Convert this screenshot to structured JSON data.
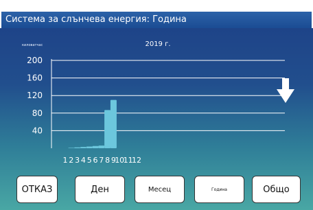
{
  "window": {
    "title": "Система за слънчева енергия: Година"
  },
  "chart_data": {
    "type": "bar",
    "title": "2019 г.",
    "ylabel": "киловатчас",
    "categories": [
      "1",
      "2",
      "3",
      "4",
      "5",
      "6",
      "7",
      "8",
      "9",
      "10",
      "11",
      "12"
    ],
    "values": [
      0,
      1,
      2,
      3,
      4,
      5,
      6,
      87,
      110,
      0,
      0,
      0
    ],
    "yticks": [
      40,
      80,
      120,
      160,
      200
    ],
    "ylim": [
      0,
      200
    ],
    "grid": true
  },
  "buttons": {
    "cancel": "ОТКАЗ",
    "day": "Ден",
    "month": "Месец",
    "year": "Година",
    "total": "Общо"
  },
  "icons": {
    "arrow": "down-arrow-icon"
  },
  "colors": {
    "bar": "#6cc7dd",
    "grid": "#ffffff"
  }
}
